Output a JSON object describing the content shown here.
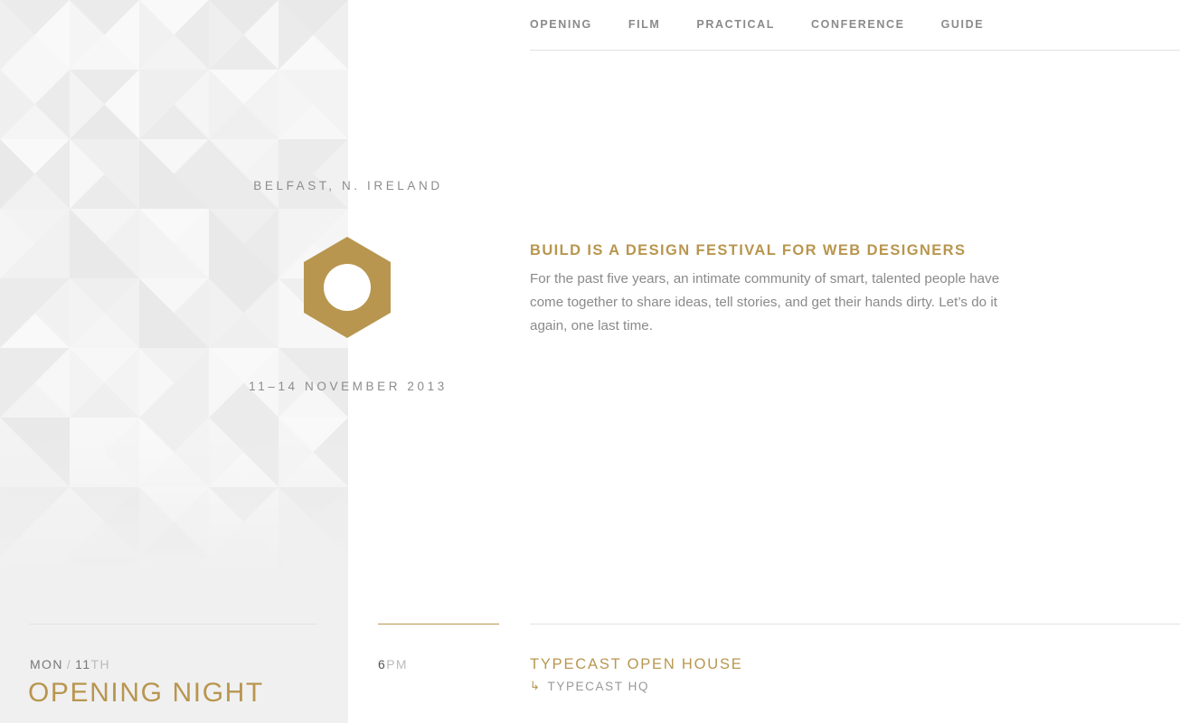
{
  "nav": {
    "items": [
      {
        "label": "OPENING"
      },
      {
        "label": "FILM"
      },
      {
        "label": "PRACTICAL"
      },
      {
        "label": "CONFERENCE"
      },
      {
        "label": "GUIDE"
      }
    ]
  },
  "branding": {
    "location": "BELFAST, N. IRELAND",
    "dates": "11–14 NOVEMBER 2013",
    "logo_icon": "hexagon-logo-icon",
    "accent_color": "#b8964f"
  },
  "intro": {
    "heading": "BUILD IS A DESIGN FESTIVAL FOR WEB DESIGNERS",
    "text": "For the past five years, an intimate community of smart, talented people have come together to share ideas, tell stories, and get their hands dirty. Let’s do it again, one last time."
  },
  "schedule": {
    "day_name": "MON",
    "day_separator": "/",
    "day_number": "11",
    "day_suffix": "TH",
    "day_title": "OPENING NIGHT",
    "time_hour": "6",
    "time_ampm": "PM",
    "event_title": "TYPECAST OPEN HOUSE",
    "venue_icon": "return-arrow-icon",
    "venue_arrow": "↳",
    "venue": "TYPECAST HQ"
  }
}
